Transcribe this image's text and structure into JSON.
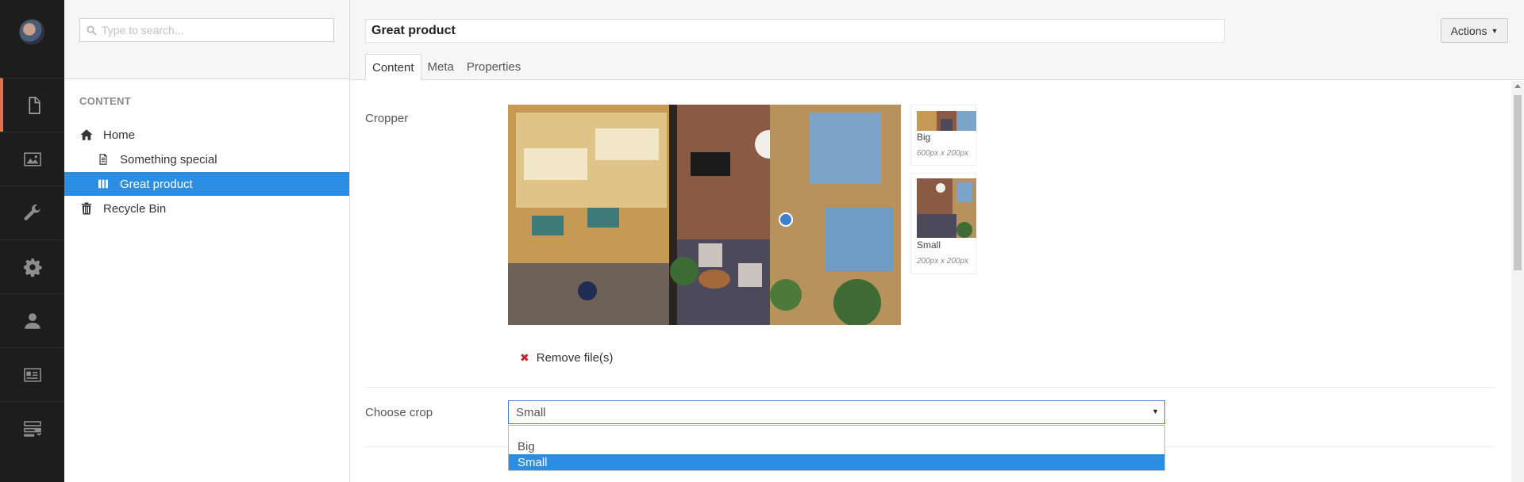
{
  "nav": {
    "items": [
      {
        "icon": "document-icon",
        "active": true
      },
      {
        "icon": "image-icon",
        "active": false
      },
      {
        "icon": "wrench-icon",
        "active": false
      },
      {
        "icon": "gear-icon",
        "active": false
      },
      {
        "icon": "user-icon",
        "active": false
      },
      {
        "icon": "contact-card-icon",
        "active": false
      },
      {
        "icon": "forms-icon",
        "active": false
      }
    ]
  },
  "tree": {
    "search_placeholder": "Type to search...",
    "section_title": "CONTENT",
    "items": [
      {
        "label": "Home",
        "icon": "home-icon",
        "selected": false
      },
      {
        "label": "Something special",
        "icon": "page-icon",
        "selected": false
      },
      {
        "label": "Great product",
        "icon": "columns-icon",
        "selected": true
      },
      {
        "label": "Recycle Bin",
        "icon": "trash-icon",
        "selected": false
      }
    ]
  },
  "editor": {
    "name_value": "Great product",
    "actions_label": "Actions",
    "tabs": [
      {
        "label": "Content",
        "active": true
      },
      {
        "label": "Meta",
        "active": false
      },
      {
        "label": "Properties",
        "active": false
      }
    ],
    "cropper": {
      "label": "Cropper",
      "crops": [
        {
          "name": "Big",
          "size": "600px x 200px"
        },
        {
          "name": "Small",
          "size": "200px x 200px"
        }
      ],
      "remove_label": "Remove file(s)"
    },
    "choose_crop": {
      "label": "Choose crop",
      "selected": "Small",
      "options": [
        "Big",
        "Small"
      ],
      "highlighted": "Small"
    }
  },
  "colors": {
    "accent": "#2b8ee2",
    "rail_bg": "#1d1d1d",
    "rail_active_marker": "#e0724e"
  }
}
